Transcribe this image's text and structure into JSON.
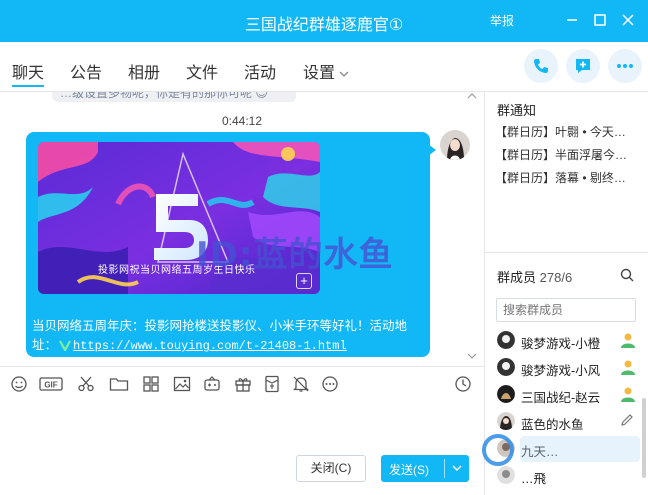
{
  "window": {
    "title": "三国战纪群雄逐鹿官①",
    "report_label": "举报"
  },
  "tabs": [
    {
      "label": "聊天",
      "active": true
    },
    {
      "label": "公告"
    },
    {
      "label": "相册"
    },
    {
      "label": "文件"
    },
    {
      "label": "活动"
    },
    {
      "label": "设置"
    }
  ],
  "chat": {
    "prev_message": "…级设置多物呢，你是有的那你可呢 😊",
    "timestamp": "0:44:12",
    "banner_caption": "投影网祝当贝网络五周岁生日快乐",
    "message_text": "当贝网络五周年庆：投影网抢楼送投影仪、小米手环等好礼！活动地址：",
    "message_link": "https://www.touying.com/t-21408-1.html",
    "watermark": "ID:蓝的水鱼"
  },
  "buttons": {
    "close": "关闭(C)",
    "send": "发送(S)"
  },
  "notice": {
    "title": "群通知",
    "items": [
      "【群日历】叶翾 • 今天…",
      "【群日历】半面浮屠今…",
      "【群日历】落幕 • 剔终…"
    ]
  },
  "members": {
    "title": "群成员",
    "count": "278/6",
    "search_placeholder": "搜索群成员",
    "list": [
      {
        "name": "骏梦游戏-小橙",
        "role": "admin"
      },
      {
        "name": "骏梦游戏-小风",
        "role": "admin"
      },
      {
        "name": "三国战纪-赵云",
        "role": "admin"
      },
      {
        "name": "蓝色的水鱼",
        "role": "edit"
      },
      {
        "name": "九天…",
        "role": ""
      },
      {
        "name": "…飛",
        "role": ""
      }
    ]
  },
  "colors": {
    "accent": "#12b7f5",
    "watermark": "#4650d2"
  }
}
